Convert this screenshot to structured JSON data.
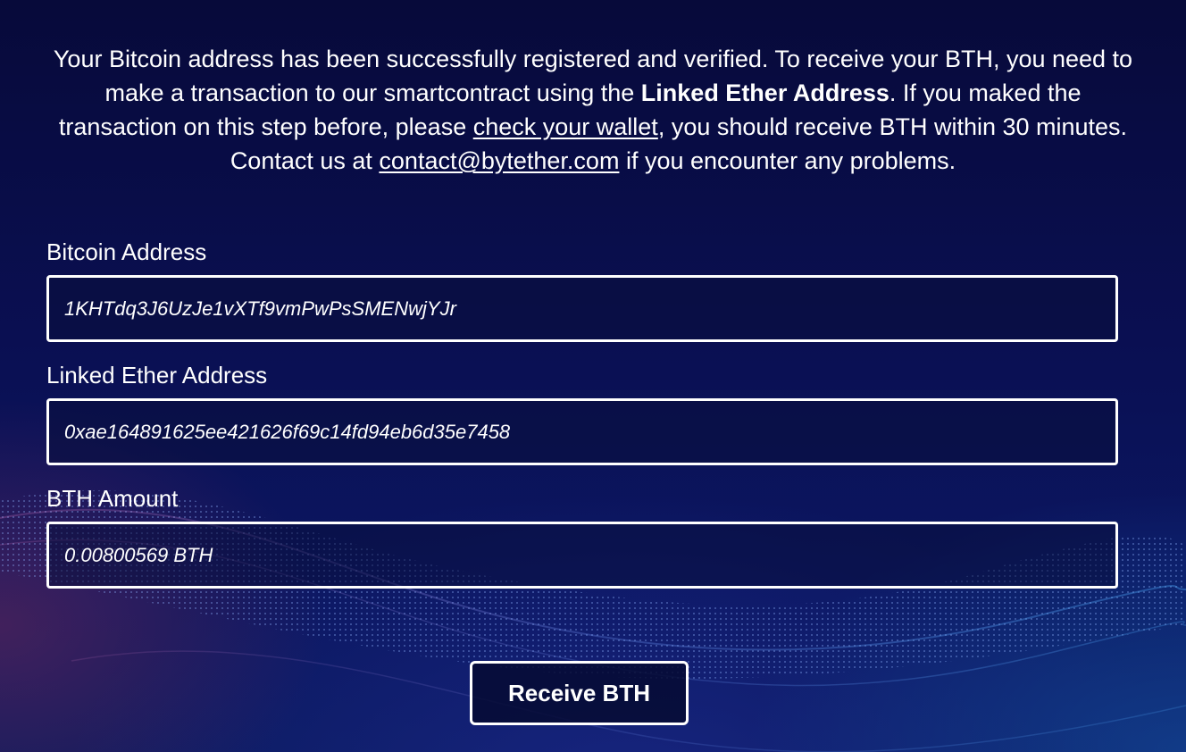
{
  "message": {
    "part1": "Your Bitcoin address has been successfully registered and verified. To receive your BTH, you need to make a transaction to our smartcontract using the ",
    "bold": "Linked Ether Address",
    "part2": ". If you maked the transaction on this step before, please ",
    "wallet_link": "check your wallet",
    "part3": ", you should receive BTH within 30 minutes. Contact us at ",
    "email_link": "contact@bytether.com",
    "part4": " if you encounter any problems."
  },
  "form": {
    "bitcoin": {
      "label": "Bitcoin Address",
      "value": "1KHTdq3J6UzJe1vXTf9vmPwPsSMENwjYJr"
    },
    "ether": {
      "label": "Linked Ether Address",
      "value": "0xae164891625ee421626f69c14fd94eb6d35e7458"
    },
    "amount": {
      "label": "BTH Amount",
      "value": "0.00800569 BTH"
    },
    "submit_label": "Receive BTH"
  },
  "colors": {
    "background": "#0a0f52",
    "text": "#ffffff",
    "border": "#ffffff"
  }
}
